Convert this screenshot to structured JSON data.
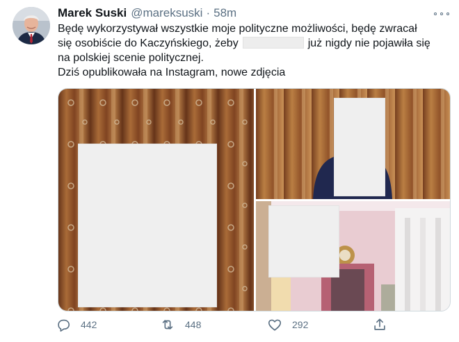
{
  "author": {
    "name": "Marek Suski",
    "handle": "@mareksuski",
    "separator": "·",
    "time": "58m"
  },
  "tweet": {
    "line1": "Będę wykorzystywał wszystkie moje polityczne możliwości, będę zwracał",
    "line2_a": "się osobiście do Kaczyńskiego, żeby",
    "line2_b": "już nigdy nie pojawiła się",
    "line3": "na polskiej scenie politycznej.",
    "line4": "Dziś opublikowała na Instagram, nowe zdjęcia"
  },
  "actions": {
    "reply_count": "442",
    "retweet_count": "448",
    "like_count": "292"
  },
  "icons": {
    "reply": "reply-icon",
    "retweet": "retweet-icon",
    "like": "heart-icon",
    "share": "share-icon",
    "more": "more-icon"
  },
  "colors": {
    "text": "#0f1419",
    "secondary": "#5b7083",
    "border": "#cfd9de"
  }
}
